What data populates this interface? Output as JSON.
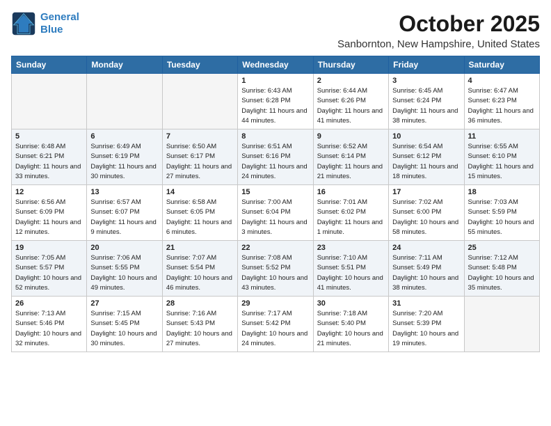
{
  "header": {
    "logo_line1": "General",
    "logo_line2": "Blue",
    "month": "October 2025",
    "location": "Sanbornton, New Hampshire, United States"
  },
  "weekdays": [
    "Sunday",
    "Monday",
    "Tuesday",
    "Wednesday",
    "Thursday",
    "Friday",
    "Saturday"
  ],
  "weeks": [
    [
      {
        "day": "",
        "sunrise": "",
        "sunset": "",
        "daylight": ""
      },
      {
        "day": "",
        "sunrise": "",
        "sunset": "",
        "daylight": ""
      },
      {
        "day": "",
        "sunrise": "",
        "sunset": "",
        "daylight": ""
      },
      {
        "day": "1",
        "sunrise": "Sunrise: 6:43 AM",
        "sunset": "Sunset: 6:28 PM",
        "daylight": "Daylight: 11 hours and 44 minutes."
      },
      {
        "day": "2",
        "sunrise": "Sunrise: 6:44 AM",
        "sunset": "Sunset: 6:26 PM",
        "daylight": "Daylight: 11 hours and 41 minutes."
      },
      {
        "day": "3",
        "sunrise": "Sunrise: 6:45 AM",
        "sunset": "Sunset: 6:24 PM",
        "daylight": "Daylight: 11 hours and 38 minutes."
      },
      {
        "day": "4",
        "sunrise": "Sunrise: 6:47 AM",
        "sunset": "Sunset: 6:23 PM",
        "daylight": "Daylight: 11 hours and 36 minutes."
      }
    ],
    [
      {
        "day": "5",
        "sunrise": "Sunrise: 6:48 AM",
        "sunset": "Sunset: 6:21 PM",
        "daylight": "Daylight: 11 hours and 33 minutes."
      },
      {
        "day": "6",
        "sunrise": "Sunrise: 6:49 AM",
        "sunset": "Sunset: 6:19 PM",
        "daylight": "Daylight: 11 hours and 30 minutes."
      },
      {
        "day": "7",
        "sunrise": "Sunrise: 6:50 AM",
        "sunset": "Sunset: 6:17 PM",
        "daylight": "Daylight: 11 hours and 27 minutes."
      },
      {
        "day": "8",
        "sunrise": "Sunrise: 6:51 AM",
        "sunset": "Sunset: 6:16 PM",
        "daylight": "Daylight: 11 hours and 24 minutes."
      },
      {
        "day": "9",
        "sunrise": "Sunrise: 6:52 AM",
        "sunset": "Sunset: 6:14 PM",
        "daylight": "Daylight: 11 hours and 21 minutes."
      },
      {
        "day": "10",
        "sunrise": "Sunrise: 6:54 AM",
        "sunset": "Sunset: 6:12 PM",
        "daylight": "Daylight: 11 hours and 18 minutes."
      },
      {
        "day": "11",
        "sunrise": "Sunrise: 6:55 AM",
        "sunset": "Sunset: 6:10 PM",
        "daylight": "Daylight: 11 hours and 15 minutes."
      }
    ],
    [
      {
        "day": "12",
        "sunrise": "Sunrise: 6:56 AM",
        "sunset": "Sunset: 6:09 PM",
        "daylight": "Daylight: 11 hours and 12 minutes."
      },
      {
        "day": "13",
        "sunrise": "Sunrise: 6:57 AM",
        "sunset": "Sunset: 6:07 PM",
        "daylight": "Daylight: 11 hours and 9 minutes."
      },
      {
        "day": "14",
        "sunrise": "Sunrise: 6:58 AM",
        "sunset": "Sunset: 6:05 PM",
        "daylight": "Daylight: 11 hours and 6 minutes."
      },
      {
        "day": "15",
        "sunrise": "Sunrise: 7:00 AM",
        "sunset": "Sunset: 6:04 PM",
        "daylight": "Daylight: 11 hours and 3 minutes."
      },
      {
        "day": "16",
        "sunrise": "Sunrise: 7:01 AM",
        "sunset": "Sunset: 6:02 PM",
        "daylight": "Daylight: 11 hours and 1 minute."
      },
      {
        "day": "17",
        "sunrise": "Sunrise: 7:02 AM",
        "sunset": "Sunset: 6:00 PM",
        "daylight": "Daylight: 10 hours and 58 minutes."
      },
      {
        "day": "18",
        "sunrise": "Sunrise: 7:03 AM",
        "sunset": "Sunset: 5:59 PM",
        "daylight": "Daylight: 10 hours and 55 minutes."
      }
    ],
    [
      {
        "day": "19",
        "sunrise": "Sunrise: 7:05 AM",
        "sunset": "Sunset: 5:57 PM",
        "daylight": "Daylight: 10 hours and 52 minutes."
      },
      {
        "day": "20",
        "sunrise": "Sunrise: 7:06 AM",
        "sunset": "Sunset: 5:55 PM",
        "daylight": "Daylight: 10 hours and 49 minutes."
      },
      {
        "day": "21",
        "sunrise": "Sunrise: 7:07 AM",
        "sunset": "Sunset: 5:54 PM",
        "daylight": "Daylight: 10 hours and 46 minutes."
      },
      {
        "day": "22",
        "sunrise": "Sunrise: 7:08 AM",
        "sunset": "Sunset: 5:52 PM",
        "daylight": "Daylight: 10 hours and 43 minutes."
      },
      {
        "day": "23",
        "sunrise": "Sunrise: 7:10 AM",
        "sunset": "Sunset: 5:51 PM",
        "daylight": "Daylight: 10 hours and 41 minutes."
      },
      {
        "day": "24",
        "sunrise": "Sunrise: 7:11 AM",
        "sunset": "Sunset: 5:49 PM",
        "daylight": "Daylight: 10 hours and 38 minutes."
      },
      {
        "day": "25",
        "sunrise": "Sunrise: 7:12 AM",
        "sunset": "Sunset: 5:48 PM",
        "daylight": "Daylight: 10 hours and 35 minutes."
      }
    ],
    [
      {
        "day": "26",
        "sunrise": "Sunrise: 7:13 AM",
        "sunset": "Sunset: 5:46 PM",
        "daylight": "Daylight: 10 hours and 32 minutes."
      },
      {
        "day": "27",
        "sunrise": "Sunrise: 7:15 AM",
        "sunset": "Sunset: 5:45 PM",
        "daylight": "Daylight: 10 hours and 30 minutes."
      },
      {
        "day": "28",
        "sunrise": "Sunrise: 7:16 AM",
        "sunset": "Sunset: 5:43 PM",
        "daylight": "Daylight: 10 hours and 27 minutes."
      },
      {
        "day": "29",
        "sunrise": "Sunrise: 7:17 AM",
        "sunset": "Sunset: 5:42 PM",
        "daylight": "Daylight: 10 hours and 24 minutes."
      },
      {
        "day": "30",
        "sunrise": "Sunrise: 7:18 AM",
        "sunset": "Sunset: 5:40 PM",
        "daylight": "Daylight: 10 hours and 21 minutes."
      },
      {
        "day": "31",
        "sunrise": "Sunrise: 7:20 AM",
        "sunset": "Sunset: 5:39 PM",
        "daylight": "Daylight: 10 hours and 19 minutes."
      },
      {
        "day": "",
        "sunrise": "",
        "sunset": "",
        "daylight": ""
      }
    ]
  ]
}
